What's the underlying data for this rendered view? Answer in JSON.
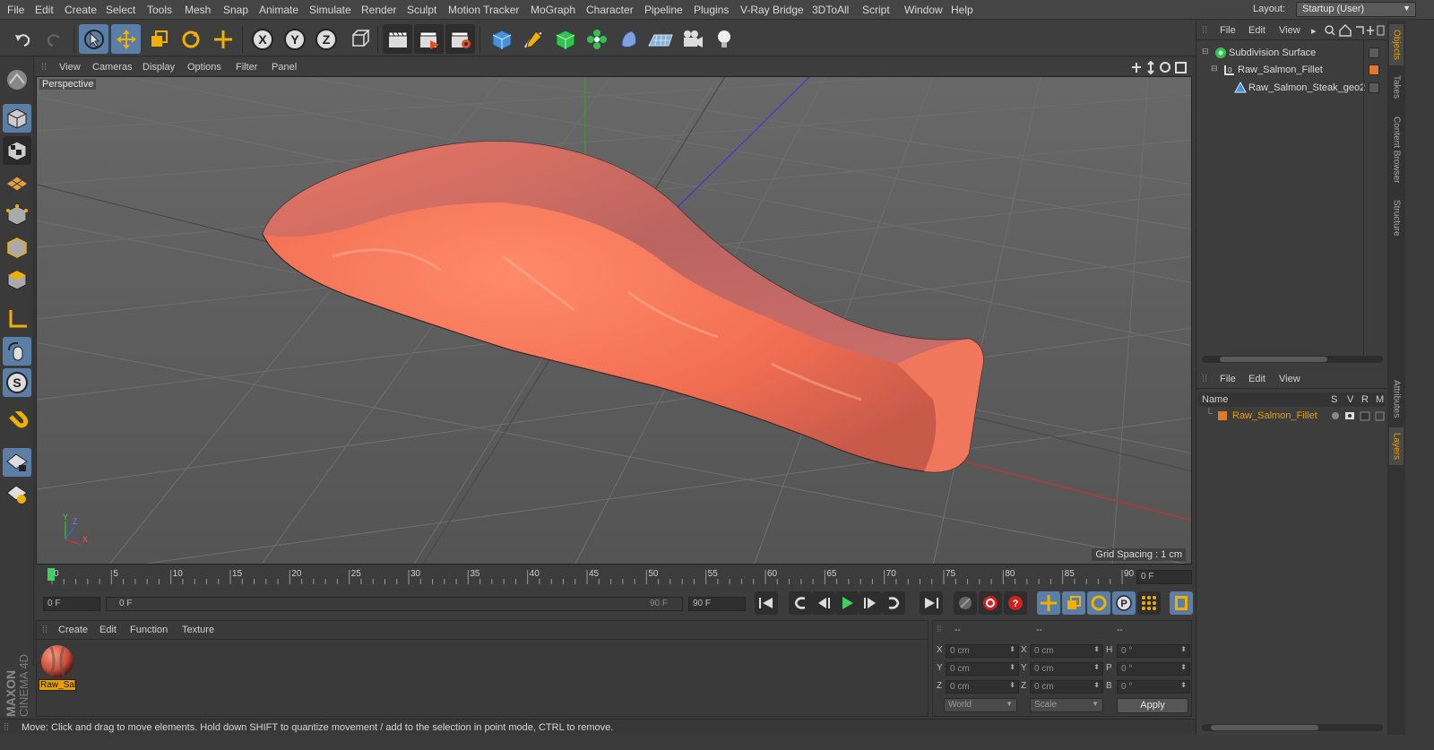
{
  "menubar": {
    "items": [
      "File",
      "Edit",
      "Create",
      "Select",
      "Tools",
      "Mesh",
      "Snap",
      "Animate",
      "Simulate",
      "Render",
      "Sculpt",
      "Motion Tracker",
      "MoGraph",
      "Character",
      "Pipeline",
      "Plugins",
      "V-Ray Bridge",
      "3DToAll",
      "Script",
      "Window",
      "Help"
    ],
    "layout_label": "Layout:",
    "layout_value": "Startup (User)"
  },
  "viewport": {
    "menu": [
      "View",
      "Cameras",
      "Display",
      "Options",
      "Filter",
      "Panel"
    ],
    "label": "Perspective",
    "grid_spacing": "Grid Spacing : 1 cm",
    "axis_x": "X",
    "axis_y": "Y",
    "axis_z": "Z"
  },
  "timeline": {
    "ticks": [
      "0",
      "5",
      "10",
      "15",
      "20",
      "25",
      "30",
      "35",
      "40",
      "45",
      "50",
      "55",
      "60",
      "65",
      "70",
      "75",
      "80",
      "85",
      "90"
    ],
    "current_frame": "0 F",
    "start_field": "0 F",
    "range_start": "0 F",
    "range_end": "90 F",
    "end_field": "90 F",
    "playhead_fraction": 0.0
  },
  "material_panel": {
    "menu": [
      "Create",
      "Edit",
      "Function",
      "Texture"
    ],
    "materials": [
      {
        "name": "Raw_Sal"
      }
    ]
  },
  "coordinates": {
    "header": [
      "--",
      "--",
      "--"
    ],
    "rows": [
      {
        "a": "X",
        "av": "0 cm",
        "b": "X",
        "bv": "0 cm",
        "c": "H",
        "cv": "0 °"
      },
      {
        "a": "Y",
        "av": "0 cm",
        "b": "Y",
        "bv": "0 cm",
        "c": "P",
        "cv": "0 °"
      },
      {
        "a": "Z",
        "av": "0 cm",
        "b": "Z",
        "bv": "0 cm",
        "c": "B",
        "cv": "0 °"
      }
    ],
    "space": "World",
    "mode": "Scale",
    "apply": "Apply"
  },
  "object_manager": {
    "menu": [
      "File",
      "Edit",
      "View"
    ],
    "objects": [
      {
        "name": "Subdivision Surface"
      },
      {
        "name": "Raw_Salmon_Fillet"
      },
      {
        "name": "Raw_Salmon_Steak_geo2"
      }
    ]
  },
  "layer_manager": {
    "menu": [
      "File",
      "Edit",
      "View"
    ],
    "columns": [
      "Name",
      "S",
      "V",
      "R",
      "M"
    ],
    "layers": [
      {
        "name": "Raw_Salmon_Fillet",
        "color": "#e07a2a"
      }
    ]
  },
  "side_tabs": {
    "top": [
      "Objects",
      "Takes",
      "Content Browser",
      "Structure"
    ],
    "bottom": [
      "Attributes",
      "Layers"
    ]
  },
  "brand": {
    "logo": "MAXON CINEMA 4D"
  },
  "status": "Move: Click and drag to move elements. Hold down SHIFT to quantize movement / add to the selection in point mode, CTRL to remove.",
  "colors": {
    "accent": "#5b7ea6",
    "salmon": "#f07a5c",
    "layer": "#e07a2a",
    "highlight": "#e8a000"
  }
}
